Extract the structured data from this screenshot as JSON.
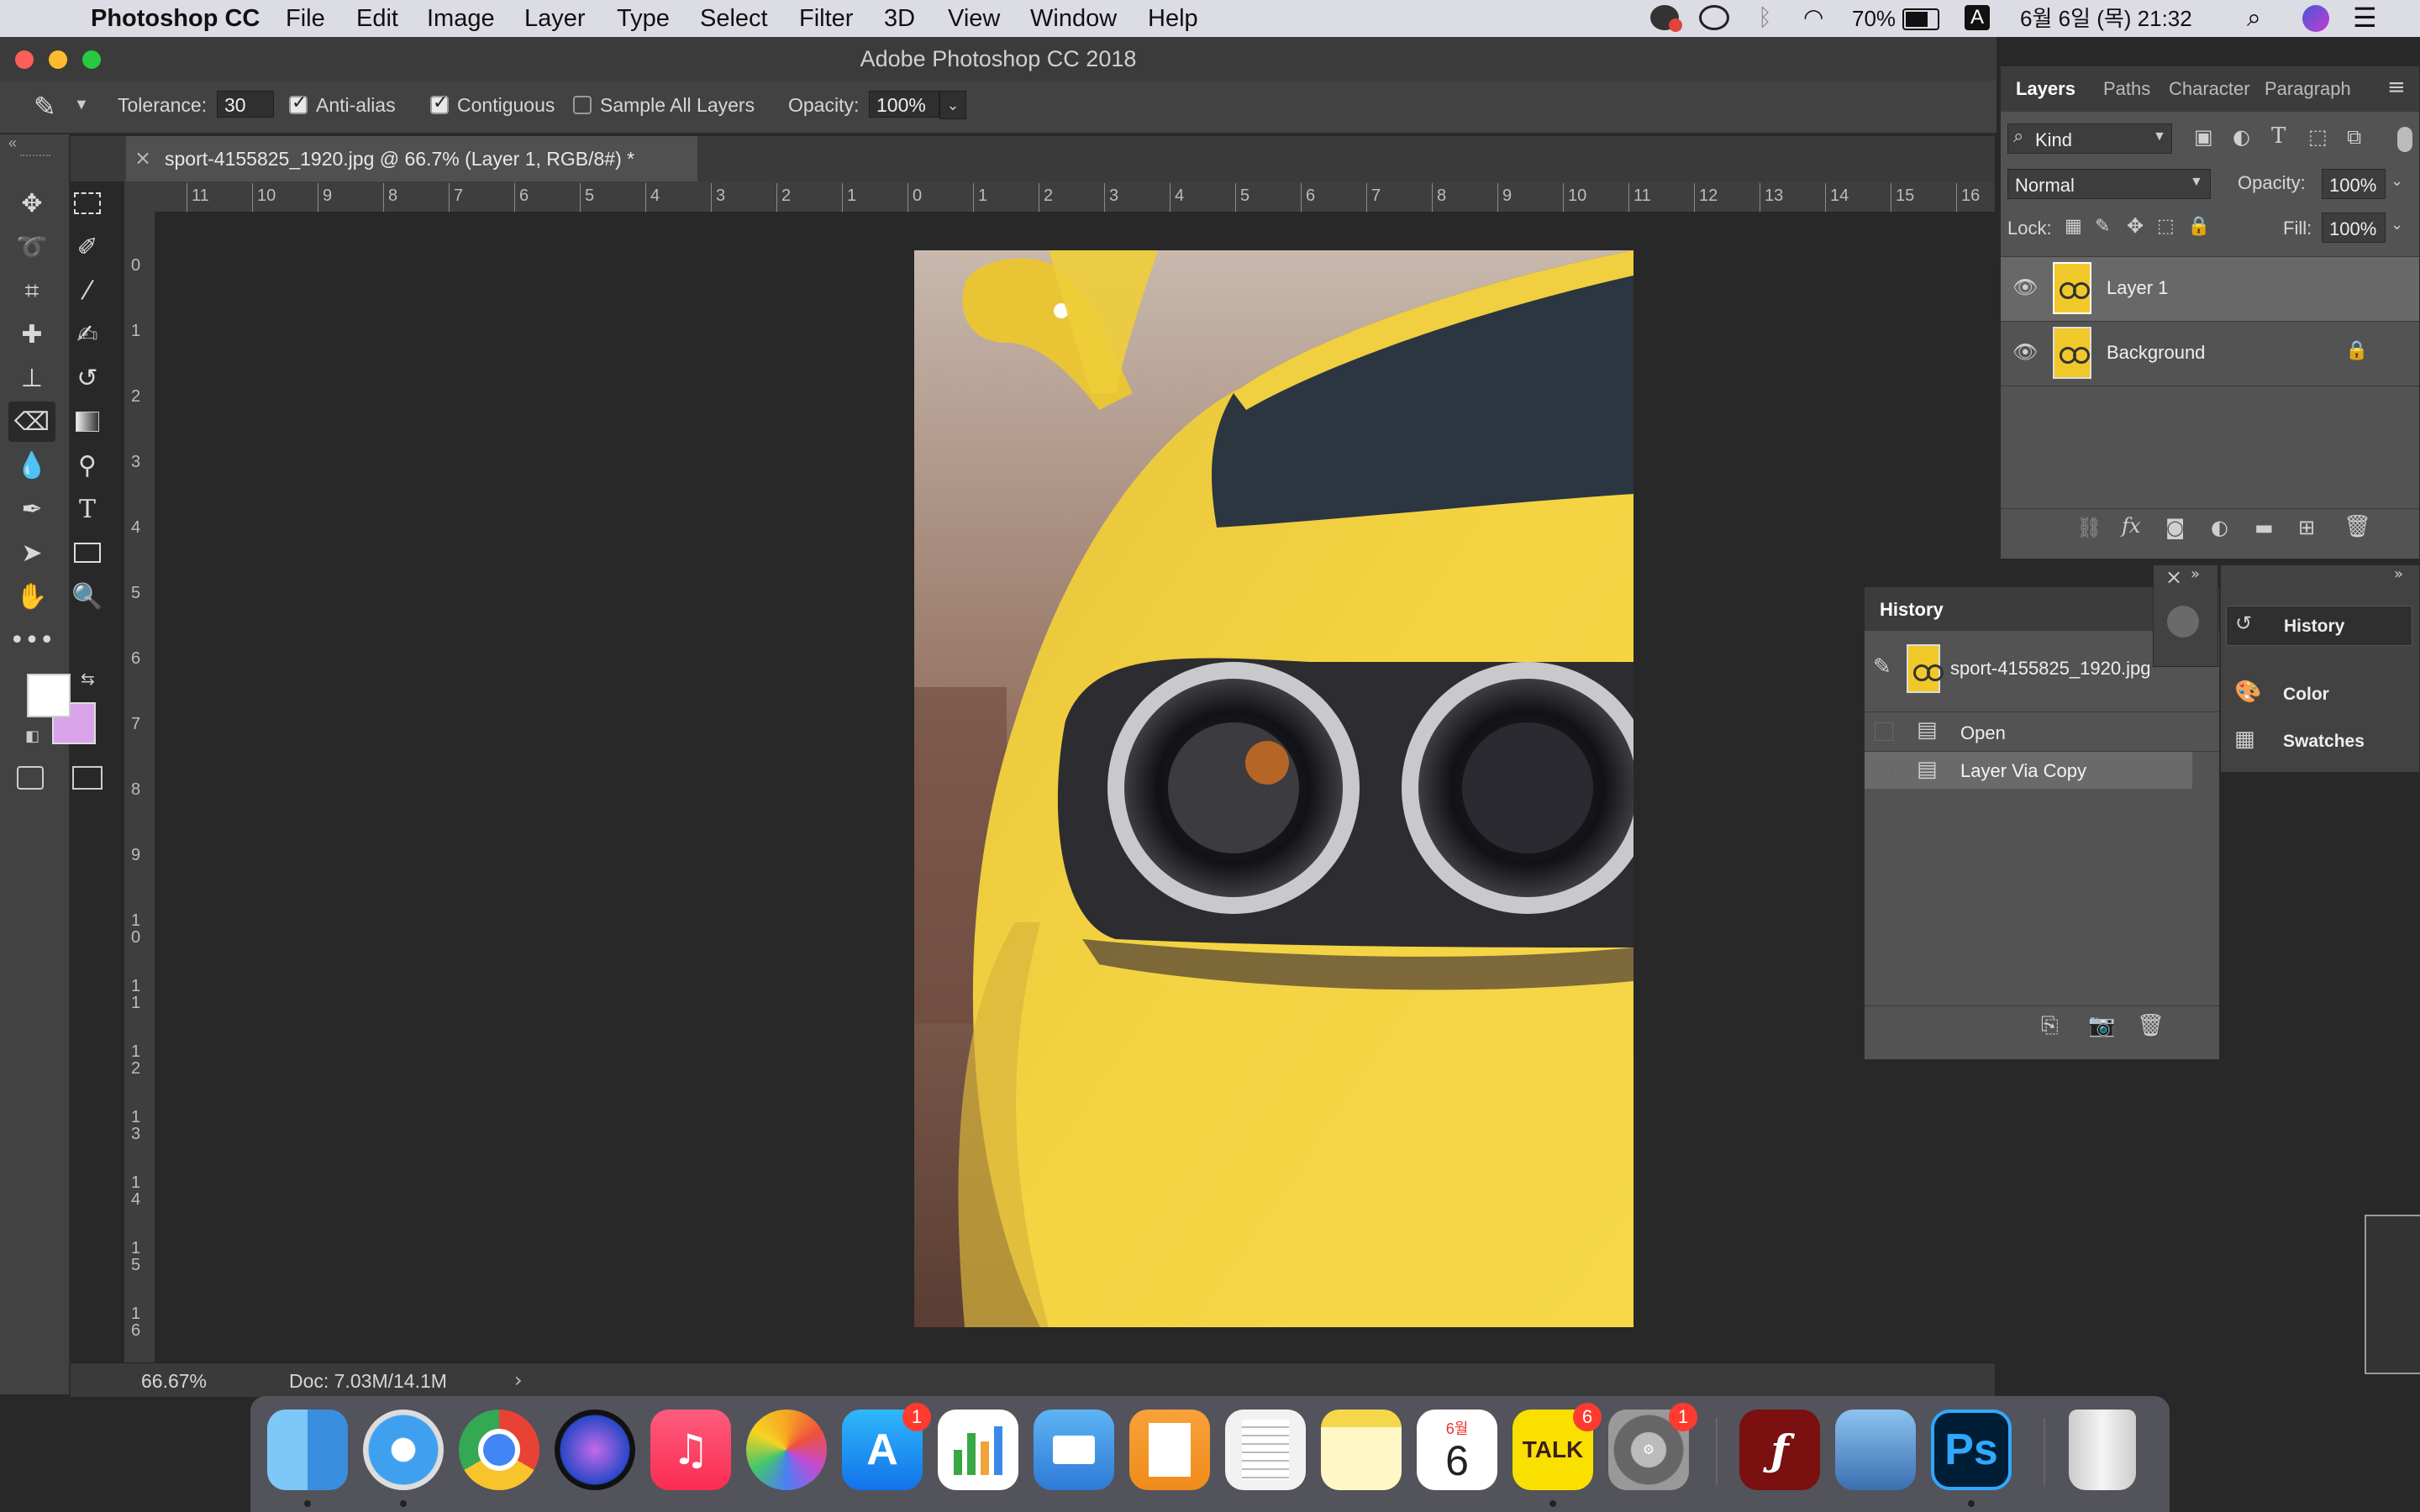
{
  "menubar": {
    "app_name": "Photoshop CC",
    "items": [
      "File",
      "Edit",
      "Image",
      "Layer",
      "Type",
      "Select",
      "Filter",
      "3D",
      "View",
      "Window",
      "Help"
    ],
    "battery": "70%",
    "input_source": "A",
    "datetime": "6월 6일 (목) 21:32"
  },
  "window": {
    "title": "Adobe Photoshop CC 2018"
  },
  "options": {
    "tolerance_label": "Tolerance:",
    "tolerance_value": "30",
    "antialias_label": "Anti-alias",
    "antialias_checked": true,
    "contiguous_label": "Contiguous",
    "contiguous_checked": true,
    "sample_all_label": "Sample All Layers",
    "sample_all_checked": false,
    "opacity_label": "Opacity:",
    "opacity_value": "100%"
  },
  "document": {
    "tab_title": "sport-4155825_1920.jpg @ 66.7% (Layer 1, RGB/8#) *",
    "ruler_h": [
      "11",
      "10",
      "9",
      "8",
      "7",
      "6",
      "5",
      "4",
      "3",
      "2",
      "1",
      "0",
      "1",
      "2",
      "3",
      "4",
      "5",
      "6",
      "7",
      "8",
      "9",
      "10",
      "11",
      "12",
      "13",
      "14",
      "15",
      "16"
    ],
    "ruler_v": [
      "0",
      "1",
      "2",
      "3",
      "4",
      "5",
      "6",
      "7",
      "8",
      "9",
      "1\n0",
      "1\n1",
      "1\n2",
      "1\n3",
      "1\n4",
      "1\n5",
      "1\n6"
    ],
    "zoom": "66.67%",
    "doc_size": "Doc: 7.03M/14.1M"
  },
  "layers_panel": {
    "tabs": [
      "Layers",
      "Paths",
      "Character",
      "Paragraph"
    ],
    "filter_kind": "Kind",
    "blend_mode": "Normal",
    "opacity_label": "Opacity:",
    "opacity_value": "100%",
    "lock_label": "Lock:",
    "fill_label": "Fill:",
    "fill_value": "100%",
    "layers": [
      {
        "name": "Layer 1",
        "selected": true
      },
      {
        "name": "Background",
        "locked": true
      }
    ]
  },
  "history_panel": {
    "title": "History",
    "snapshot": "sport-4155825_1920.jpg",
    "states": [
      "Open",
      "Layer Via Copy"
    ]
  },
  "collapsed_panels": {
    "items": [
      "History",
      "Color",
      "Swatches"
    ]
  },
  "dock": {
    "badges": {
      "appstore": "1",
      "kakaotalk": "6",
      "sysprefs": "1"
    },
    "calendar_month": "6월",
    "calendar_day": "6",
    "kakao_label": "TALK",
    "ps_label": "Ps"
  },
  "colors": {
    "foreground": "#ffffff",
    "background": "#d9a3ea",
    "car_yellow": "#f2cf3a",
    "ps_blue": "#31a8ff"
  }
}
